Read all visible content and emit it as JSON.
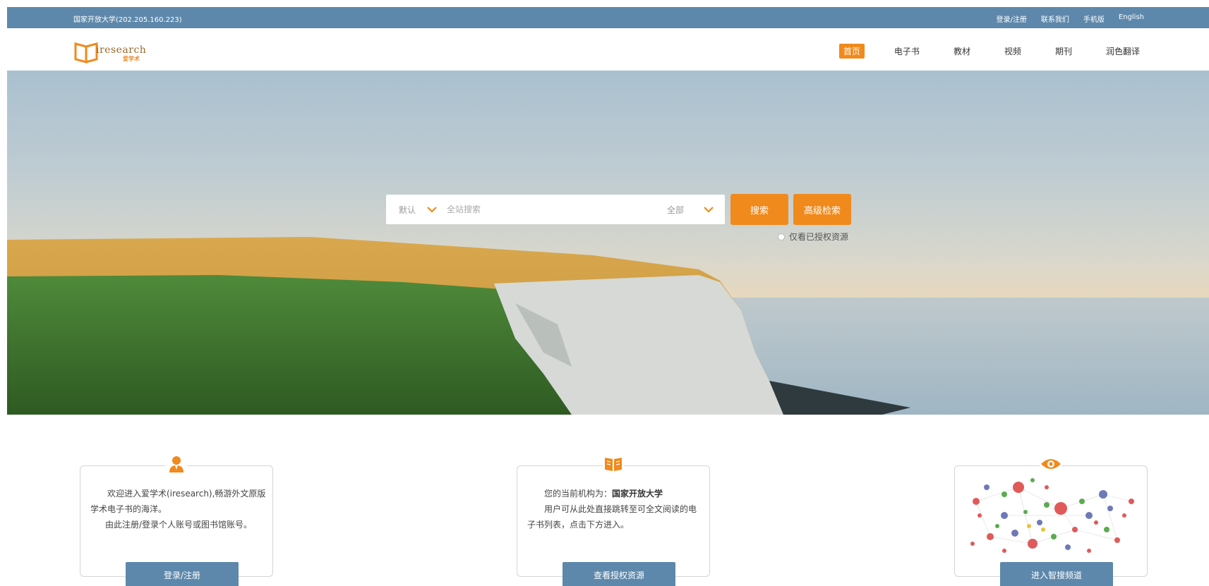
{
  "topbar": {
    "institution": "国家开放大学(202.205.160.223)",
    "links": [
      "登录/注册",
      "联系我们",
      "手机版",
      "English"
    ]
  },
  "logo": {
    "word": "iresearch",
    "sub": "爱学术"
  },
  "nav": {
    "items": [
      "首页",
      "电子书",
      "教材",
      "视频",
      "期刊",
      "润色翻译"
    ],
    "active": "首页"
  },
  "search": {
    "scope_value": "默认",
    "placeholder": "全站搜索",
    "type_value": "全部",
    "search_button": "搜索",
    "advanced_button": "高级检索",
    "authorized_only_label": "仅看已授权资源"
  },
  "cards": {
    "welcome": {
      "line1": "欢迎进入爱学术(iresearch),畅游外文原版学术电子书的海洋。",
      "line2": "由此注册/登录个人账号或图书馆账号。",
      "button": "登录/注册"
    },
    "institution": {
      "label": "您的当前机构为：",
      "name": "国家开放大学",
      "desc": "用户可从此处直接跳转至可全文阅读的电子书列表，点击下方进入。",
      "button": "查看授权资源"
    },
    "smart": {
      "button": "进入智搜频道"
    }
  },
  "colors": {
    "topbar": "#5d88ab",
    "accent": "#f08a1c",
    "card_button": "#5d88ab"
  },
  "icons": [
    "user-icon",
    "book-icon",
    "eye-icon",
    "chevron-down-icon"
  ]
}
